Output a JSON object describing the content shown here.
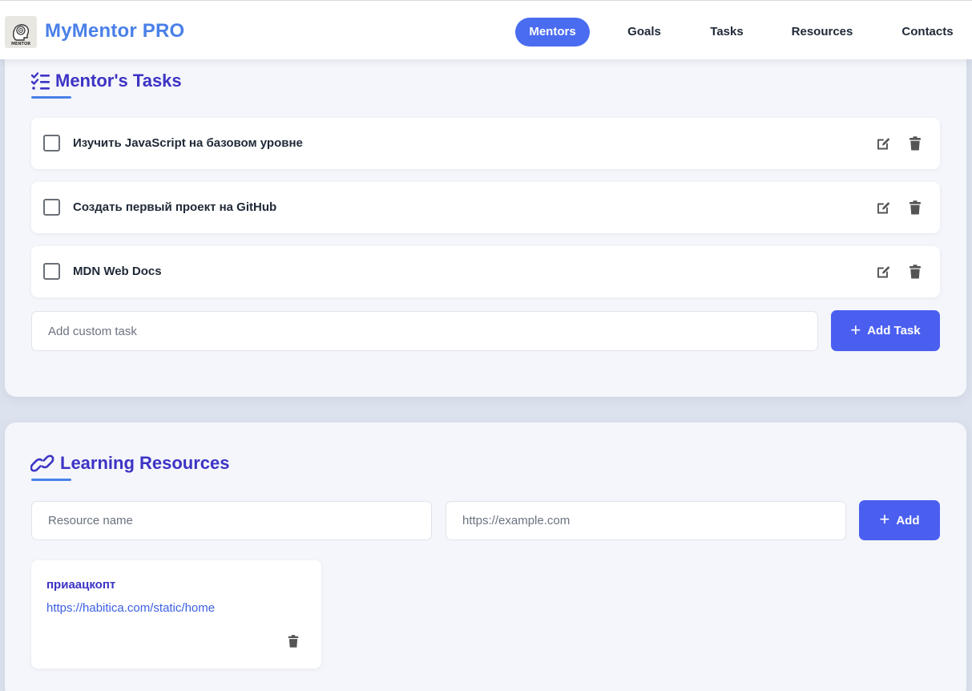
{
  "header": {
    "brand": "MyMentor PRO",
    "logo_text": "MENTOR",
    "nav": [
      {
        "label": "Mentors",
        "active": true
      },
      {
        "label": "Goals",
        "active": false
      },
      {
        "label": "Tasks",
        "active": false
      },
      {
        "label": "Resources",
        "active": false
      },
      {
        "label": "Contacts",
        "active": false
      }
    ]
  },
  "tasks_section": {
    "title": "Mentor's Tasks",
    "title_icon": "list-check-icon",
    "items": [
      {
        "text": "Изучить JavaScript на базовом уровне",
        "checked": false
      },
      {
        "text": "Создать первый проект на GitHub",
        "checked": false
      },
      {
        "text": "MDN Web Docs",
        "checked": false
      }
    ],
    "custom_task_placeholder": "Add custom task",
    "add_button_label": "Add Task"
  },
  "resources_section": {
    "title": "Learning Resources",
    "title_icon": "link-icon",
    "name_placeholder": "Resource name",
    "url_placeholder": "https://example.com",
    "add_button_label": "Add",
    "items": [
      {
        "name": "приаацкопт",
        "url": "https://habitica.com/static/home"
      }
    ]
  },
  "colors": {
    "accent": "#4a5ff0",
    "brand": "#4a80e8",
    "title": "#3d33c4",
    "link": "#3b5fe0"
  }
}
